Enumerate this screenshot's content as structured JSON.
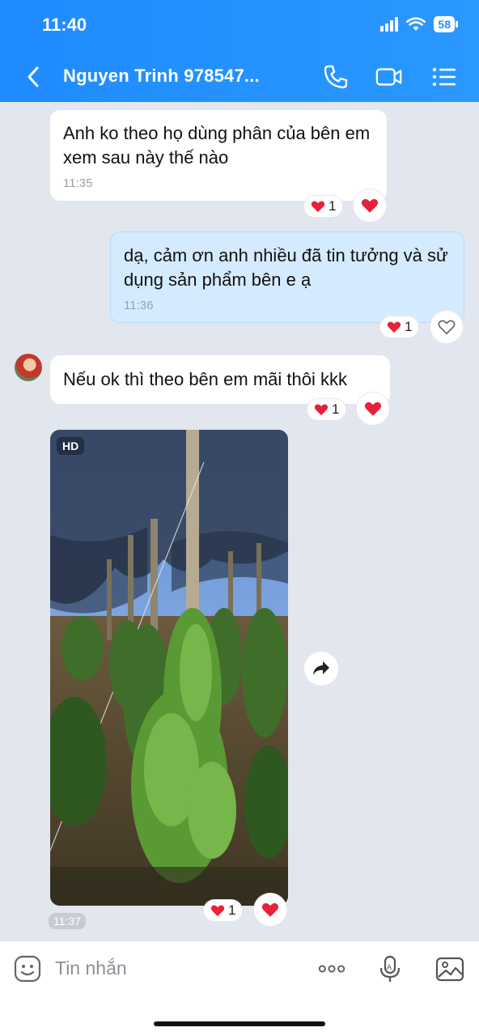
{
  "status": {
    "time": "11:40",
    "battery": "58"
  },
  "header": {
    "title": "Nguyen Trinh 978547..."
  },
  "messages": [
    {
      "text": "Anh ko theo họ dùng phân của bên em xem sau này thế nào",
      "time": "11:35",
      "reaction_count": "1"
    },
    {
      "text": "dạ, cảm ơn anh nhiều đã tin tưởng và sử dụng sản phẩm bên e ạ",
      "time": "11:36",
      "reaction_count": "1"
    },
    {
      "text": "Nếu ok thì theo bên em mãi thôi kkk",
      "reaction_count": "1"
    }
  ],
  "photo": {
    "badge": "HD",
    "time": "11:37",
    "reaction_count": "1"
  },
  "composer": {
    "placeholder": "Tin nhắn"
  },
  "icons": [
    "back-icon",
    "phone-icon",
    "video-call-icon",
    "menu-icon",
    "heart-icon",
    "share-icon",
    "emoji-icon",
    "more-icon",
    "microphone-icon",
    "image-icon"
  ],
  "colors": {
    "header": "#2a98ff",
    "outgoing_bubble": "#d4ebff",
    "incoming_bubble": "#ffffff",
    "background": "#e2e6ee",
    "heart": "#e8213a"
  }
}
